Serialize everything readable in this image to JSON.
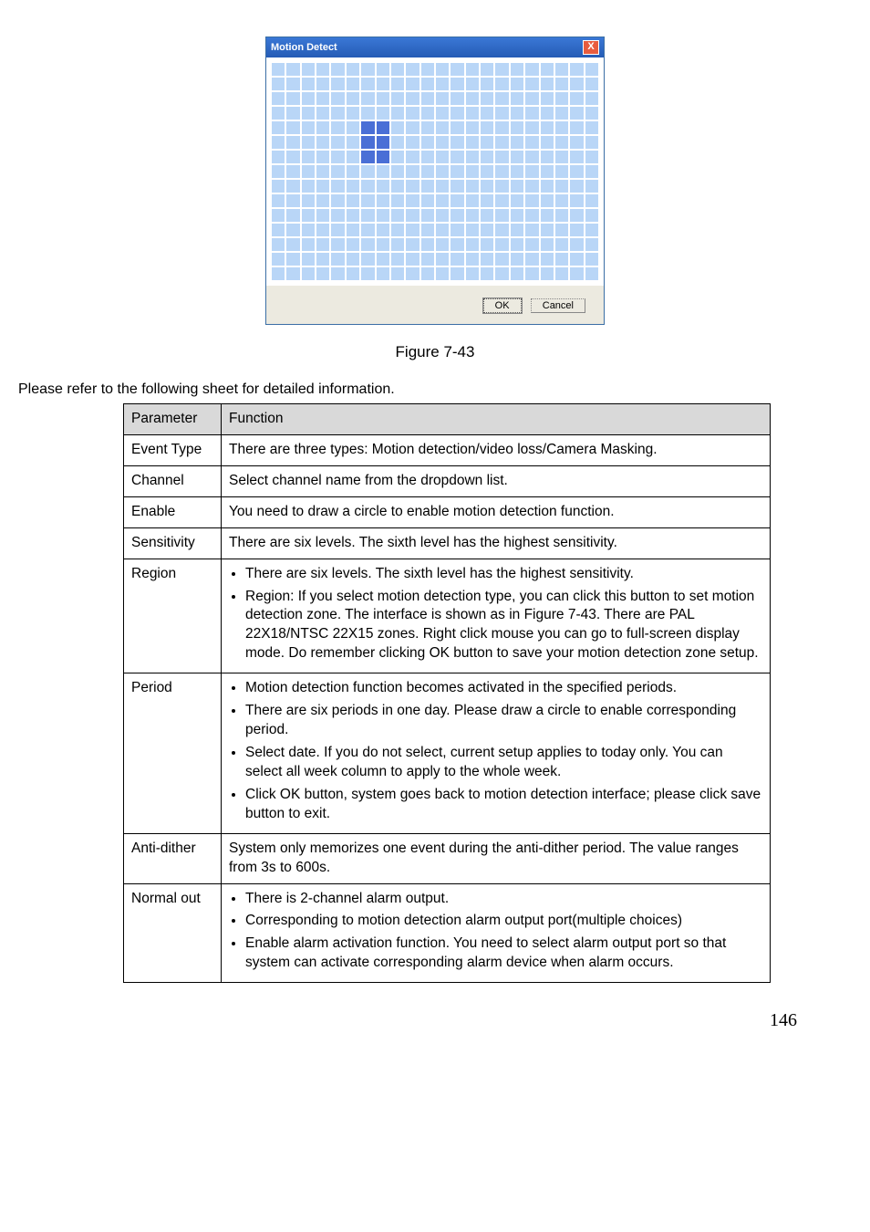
{
  "dialog": {
    "title": "Motion Detect",
    "close": "X",
    "ok": "OK",
    "cancel": "Cancel"
  },
  "figure": {
    "caption": "Figure 7-43"
  },
  "intro": "Please refer to the following sheet for detailed information.",
  "table": {
    "header_param": "Parameter",
    "header_func": "Function",
    "rows": {
      "event_type": {
        "param": "Event Type",
        "func": "There are three types: Motion detection/video loss/Camera Masking."
      },
      "channel": {
        "param": "Channel",
        "func": "Select channel name from the dropdown list."
      },
      "enable": {
        "param": "Enable",
        "func": "You need to draw a circle to enable motion detection function."
      },
      "sensitivity": {
        "param": "Sensitivity",
        "func": "There are six levels.  The sixth level has the highest sensitivity."
      },
      "region": {
        "param": "Region",
        "b1": "There are six levels.  The sixth level has the highest sensitivity.",
        "b2": "Region: If you select motion detection type, you can click this button to set motion detection zone.  The interface is shown as in Figure 7-43. There are PAL 22X18/NTSC 22X15 zones. Right click mouse you can go to full-screen display mode. Do remember clicking OK button to save your motion detection zone setup."
      },
      "period": {
        "param": "Period",
        "b1": "Motion detection function becomes activated in the specified periods.",
        "b2": "There are six periods in one day. Please draw a circle to enable corresponding period.",
        "b3": "Select date. If you do not select, current setup applies to today only. You can select all week column to apply to the whole week.",
        "b4": "Click OK button, system goes back to motion detection interface; please click save button to exit."
      },
      "anti_dither": {
        "param": "Anti-dither",
        "func": "System only memorizes one event during the anti-dither period. The value ranges from 3s to 600s."
      },
      "normal_out": {
        "param": "Normal out",
        "b1": "There is 2-channel alarm output.",
        "b2": "Corresponding to motion detection alarm output port(multiple choices)",
        "b3": "Enable alarm activation function. You need to select alarm output port so that system can activate corresponding alarm device when alarm occurs."
      }
    }
  },
  "page_number": "146"
}
